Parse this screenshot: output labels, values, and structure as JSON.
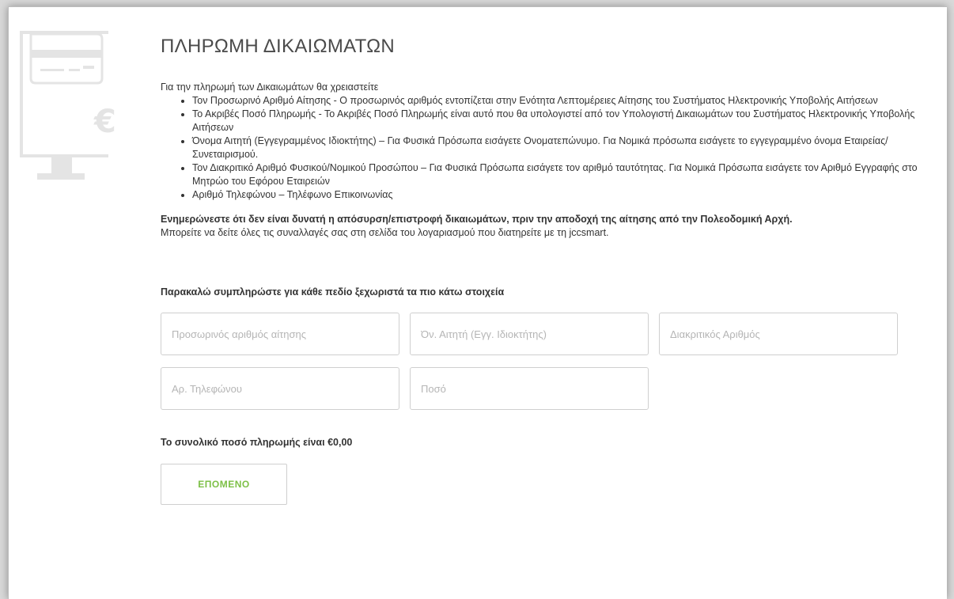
{
  "page": {
    "title": "ΠΛΗΡΩΜΗ ΔΙΚΑΙΩΜΑΤΩΝ",
    "intro": "Για την πληρωμή των Δικαιωμάτων θα χρειαστείτε",
    "requirements": [
      "Τον Προσωρινό Αριθμό Αίτησης - Ο προσωρινός αριθμός εντοπίζεται στην Ενότητα Λεπτομέρειες Αίτησης του Συστήματος Ηλεκτρονικής Υποβολής Αιτήσεων",
      "Το Ακριβές Ποσό Πληρωμής - Το Ακριβές Ποσό Πληρωμής είναι αυτό που θα υπολογιστεί από τον Υπολογιστή Δικαιωμάτων του Συστήματος Ηλεκτρονικής Υποβολής Αιτήσεων",
      "Όνομα Αιτητή (Εγγεγραμμένος Ιδιοκτήτης) – Για Φυσικά Πρόσωπα εισάγετε Ονοματεπώνυμο. Για Νομικά πρόσωπα εισάγετε το εγγεγραμμένο όνομα Εταιρείας/Συνεταιρισμού.",
      "Τον Διακριτικό Αριθμό Φυσικού/Νομικού Προσώπου – Για Φυσικά Πρόσωπα εισάγετε τον αριθμό ταυτότητας. Για Νομικά Πρόσωπα εισάγετε τον Αριθμό Εγγραφής στο Μητρώο του Εφόρου Εταιρειών",
      "Αριθμό Τηλεφώνου – Τηλέφωνο Επικοινωνίας"
    ],
    "warning_bold": "Ενημερώνεστε ότι δεν είναι δυνατή η απόσυρση/επιστροφή δικαιωμάτων, πριν την αποδοχή της αίτησης από την Πολεοδομική Αρχή.",
    "warning_note": "Μπορείτε να δείτε όλες τις συναλλαγές σας στη σελίδα του λογαριασμού που διατηρείτε με τη jccsmart."
  },
  "form": {
    "title": "Παρακαλώ συμπληρώστε για κάθε πεδίο ξεχωριστά τα πιο κάτω στοιχεία",
    "fields": {
      "application_number": {
        "placeholder": "Προσωρινός αριθμός αίτησης",
        "value": ""
      },
      "applicant_name": {
        "placeholder": "Όν. Αιτητή (Εγγ. Ιδιοκτήτης)",
        "value": ""
      },
      "id_number": {
        "placeholder": "Διακριτικός Αριθμός",
        "value": ""
      },
      "phone": {
        "placeholder": "Αρ. Τηλεφώνου",
        "value": ""
      },
      "amount": {
        "placeholder": "Ποσό",
        "value": ""
      }
    },
    "total_text": "Το συνολικό ποσό πληρωμής είναι €0,00",
    "next_label": "ΕΠΟΜΕΝΟ"
  },
  "icons": {
    "illustration": "computer-payment-euro-icon"
  },
  "colors": {
    "accent": "#7dc047",
    "illustration": "#e3e3e3"
  }
}
